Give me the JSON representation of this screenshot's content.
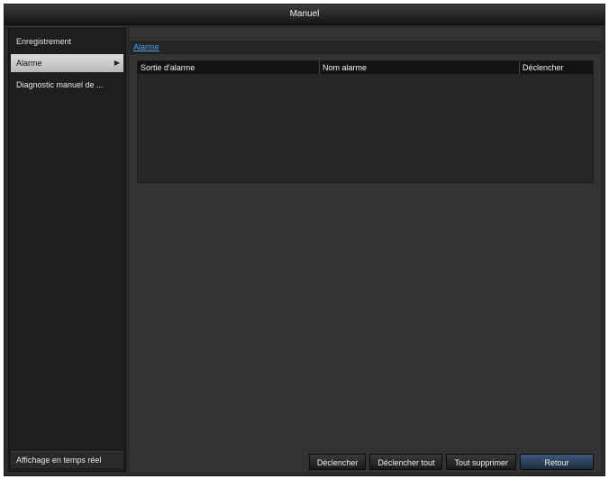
{
  "window": {
    "title": "Manuel"
  },
  "sidebar": {
    "items": [
      {
        "label": "Enregistrement"
      },
      {
        "label": "Alarme"
      },
      {
        "label": "Diagnostic manuel de ..."
      }
    ],
    "bottom_label": "Affichage en temps réel"
  },
  "main": {
    "tab_label": "Alarme",
    "table": {
      "columns": [
        "Sortie d'alarme",
        "Nom alarme",
        "Déclencher"
      ],
      "rows": []
    },
    "buttons": {
      "trigger": "Déclencher",
      "trigger_all": "Déclencher tout",
      "clear_all": "Tout supprimer",
      "back": "Retour"
    }
  },
  "icons": {
    "active_chevron": "chevron-right-icon"
  },
  "colors": {
    "tab_link": "#4aa6e8",
    "primary_button": "#2b4360"
  }
}
